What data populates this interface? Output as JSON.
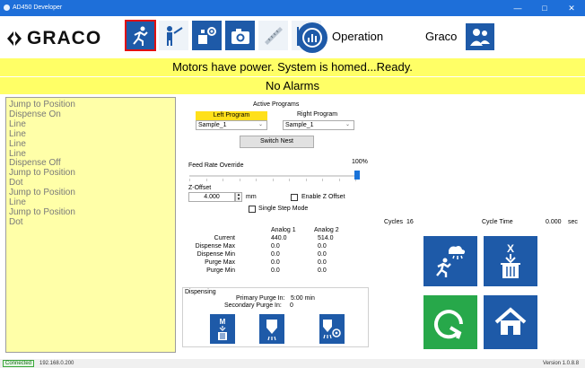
{
  "window": {
    "title": "AD450 Developer",
    "controls": {
      "minimize": "—",
      "maximize": "□",
      "close": "✕"
    }
  },
  "header": {
    "logo": "GRACO",
    "toolbar_icons": [
      "operation-icon",
      "maintenance-icon",
      "setup-icon",
      "camera-icon",
      "calibration-icon",
      "chart-icon",
      "gauge-icon"
    ],
    "screen_label": "Operation",
    "user_label": "Graco"
  },
  "banners": {
    "status": "Motors have power. System is homed...Ready.",
    "alarms": "No Alarms"
  },
  "program_list": [
    "Jump to Position",
    "Dispense On",
    "Line",
    "Line",
    "Line",
    "Line",
    "Dispense Off",
    "Jump to Position",
    "Dot",
    "Jump to Position",
    "Line",
    "Jump to Position",
    "Dot"
  ],
  "programs": {
    "title": "Active Programs",
    "left_label": "Left Program",
    "right_label": "Right Program",
    "left_value": "Sample_1",
    "right_value": "Sample_1",
    "switch_nest": "Switch Nest"
  },
  "feed_rate": {
    "label": "Feed Rate Override",
    "value_text": "100%",
    "value_pct": 100
  },
  "z_offset": {
    "label": "Z-Offset",
    "value": "4.000",
    "unit": "mm",
    "enable_label": "Enable Z Offset",
    "single_step_label": "Single Step Mode"
  },
  "analog": {
    "headers": [
      "Analog 1",
      "Analog 2"
    ],
    "rows": [
      {
        "name": "Current",
        "a1": "440.0",
        "a2": "514.0"
      },
      {
        "name": "Dispense Max",
        "a1": "0.0",
        "a2": "0.0"
      },
      {
        "name": "Dispense Min",
        "a1": "0.0",
        "a2": "0.0"
      },
      {
        "name": "Purge Max",
        "a1": "0.0",
        "a2": "0.0"
      },
      {
        "name": "Purge Min",
        "a1": "0.0",
        "a2": "0.0"
      }
    ]
  },
  "dispensing": {
    "title": "Dispensing",
    "primary_label": "Primary Purge In:",
    "primary_value": "5:00 min",
    "secondary_label": "Secondary Purge In:",
    "secondary_value": "0"
  },
  "cycles": {
    "label": "Cycles",
    "value": "16",
    "time_label": "Cycle Time",
    "time_value": "0.000",
    "time_unit": "sec"
  },
  "status_bar": {
    "connected": "Connected",
    "ip": "192.168.0.200",
    "version": "Version 1.0.8.8"
  },
  "colors": {
    "brand_blue": "#1e5aa8",
    "banner_yellow": "#ffff66",
    "panel_yellow": "#ffffa8",
    "go_green": "#27a84a",
    "titlebar": "#1e6fd9"
  }
}
